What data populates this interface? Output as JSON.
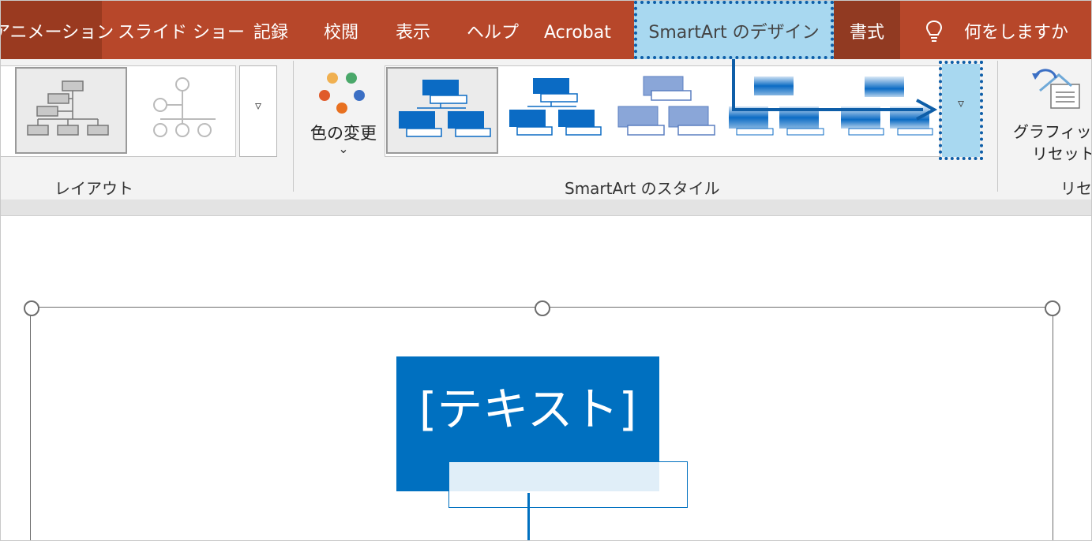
{
  "tabs": [
    {
      "label": "アニメーション"
    },
    {
      "label": "スライド ショー"
    },
    {
      "label": "記録"
    },
    {
      "label": "校閲"
    },
    {
      "label": "表示"
    },
    {
      "label": "ヘルプ"
    },
    {
      "label": "Acrobat"
    },
    {
      "label": "SmartArt のデザイン"
    },
    {
      "label": "書式"
    }
  ],
  "tell_me": {
    "label": "何をしますか",
    "icon": "lightbulb-icon"
  },
  "ribbon": {
    "layout_group": {
      "label": "レイアウト"
    },
    "styles_group": {
      "label": "SmartArt のスタイル"
    },
    "color_change": {
      "label": "色の変更",
      "arrow": "⌄"
    },
    "reset_group": {
      "label": "リセット",
      "button_line1": "グラフィックの",
      "button_line2": "リセット"
    },
    "more_glyph": "▿"
  },
  "slide": {
    "placeholder_text": "[テキスト]"
  },
  "colors": {
    "tab_bar": "#b7472a",
    "accent_highlight": "#a8d8f0",
    "annotation_blue": "#0e5ea8",
    "smartart_blue": "#0070c0"
  }
}
